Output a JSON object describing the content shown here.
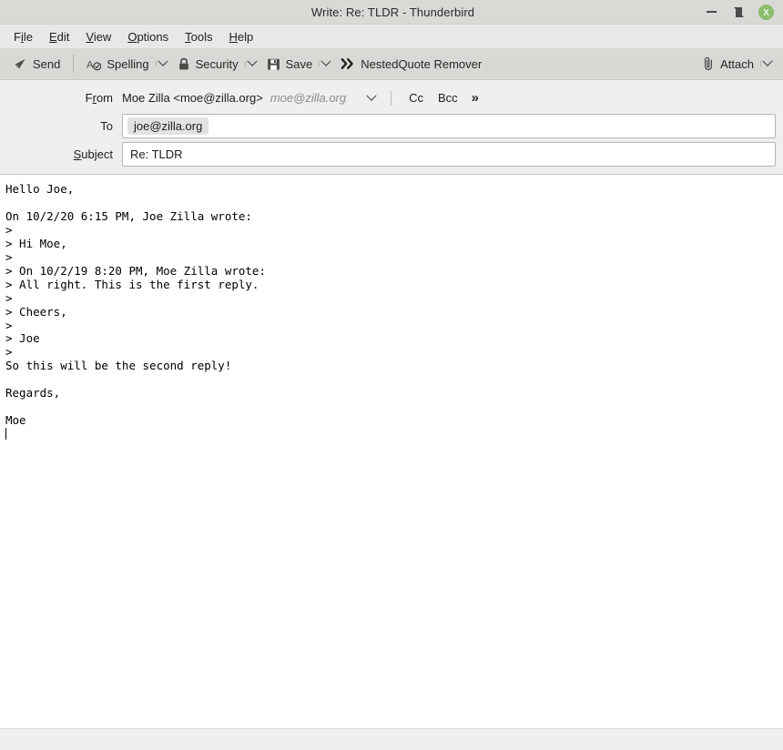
{
  "window": {
    "title": "Write: Re: TLDR - Thunderbird",
    "controls": {
      "minimize": "minimize",
      "maximize": "restore",
      "close": "x"
    },
    "close_color": "#8bbd6d"
  },
  "menubar": {
    "items": [
      {
        "label": "File",
        "pre": "F",
        "key": "i",
        "post": "le"
      },
      {
        "label": "Edit",
        "pre": "",
        "key": "E",
        "post": "dit"
      },
      {
        "label": "View",
        "pre": "",
        "key": "V",
        "post": "iew"
      },
      {
        "label": "Options",
        "pre": "",
        "key": "O",
        "post": "ptions"
      },
      {
        "label": "Tools",
        "pre": "",
        "key": "T",
        "post": "ools"
      },
      {
        "label": "Help",
        "pre": "",
        "key": "H",
        "post": "elp"
      }
    ]
  },
  "toolbar": {
    "send_label": "Send",
    "send_icon": "paper-plane-icon",
    "spelling_label": "Spelling",
    "spelling_icon": "spellcheck-icon",
    "security_label": "Security",
    "security_icon": "lock-icon",
    "save_label": "Save",
    "save_icon": "floppy-disk-icon",
    "nestedquote_label": "NestedQuote Remover",
    "nestedquote_icon": "double-chevron-right-icon",
    "attach_label": "Attach",
    "attach_icon": "paperclip-icon",
    "dropdown_icon": "chevron-down-icon"
  },
  "headers": {
    "from": {
      "label_pre": "F",
      "label_key": "r",
      "label_post": "om",
      "label": "From",
      "value": "Moe Zilla <moe@zilla.org>",
      "identity": "moe@zilla.org"
    },
    "cc_label": "Cc",
    "bcc_label": "Bcc",
    "more_label": "»",
    "to": {
      "label": "To",
      "recipients": [
        "joe@zilla.org"
      ],
      "placeholder": ""
    },
    "subject": {
      "label_pre": "",
      "label_key": "S",
      "label_post": "ubject",
      "label": "Subject",
      "value": "Re: TLDR",
      "placeholder": ""
    }
  },
  "body": {
    "content": "Hello Joe,\n\nOn 10/2/20 6:15 PM, Joe Zilla wrote:\n>\n> Hi Moe,\n>\n> On 10/2/19 8:20 PM, Moe Zilla wrote:\n> All right. This is the first reply.\n>\n> Cheers,\n>\n> Joe\n>\nSo this will be the second reply!\n\nRegards,\n\nMoe\n"
  },
  "statusbar": {
    "text": ""
  }
}
